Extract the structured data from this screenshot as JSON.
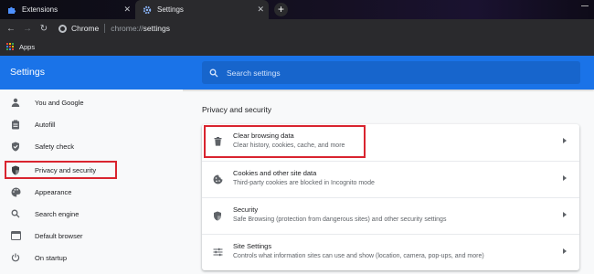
{
  "tabs": [
    {
      "label": "Extensions",
      "icon": "puzzle-icon"
    },
    {
      "label": "Settings",
      "icon": "gear-icon"
    }
  ],
  "toolbar": {
    "site_label": "Chrome",
    "url_scheme": "chrome://",
    "url_path": "settings"
  },
  "bookmarks": {
    "apps_label": "Apps"
  },
  "header": {
    "title": "Settings",
    "search_placeholder": "Search settings"
  },
  "sidebar": {
    "items": [
      {
        "label": "You and Google",
        "icon": "person-icon"
      },
      {
        "label": "Autofill",
        "icon": "clipboard-icon"
      },
      {
        "label": "Safety check",
        "icon": "shield-check-icon"
      },
      {
        "label": "Privacy and security",
        "icon": "shield-icon"
      },
      {
        "label": "Appearance",
        "icon": "palette-icon"
      },
      {
        "label": "Search engine",
        "icon": "search-icon"
      },
      {
        "label": "Default browser",
        "icon": "browser-icon"
      },
      {
        "label": "On startup",
        "icon": "power-icon"
      }
    ]
  },
  "main": {
    "section_title": "Privacy and security",
    "rows": [
      {
        "title": "Clear browsing data",
        "subtitle": "Clear history, cookies, cache, and more",
        "icon": "trash-icon"
      },
      {
        "title": "Cookies and other site data",
        "subtitle": "Third-party cookies are blocked in Incognito mode",
        "icon": "cookie-icon"
      },
      {
        "title": "Security",
        "subtitle": "Safe Browsing (protection from dangerous sites) and other security settings",
        "icon": "shield-icon"
      },
      {
        "title": "Site Settings",
        "subtitle": "Controls what information sites can use and show (location, camera, pop-ups, and more)",
        "icon": "sliders-icon"
      }
    ]
  },
  "colors": {
    "accent": "#1a73e8",
    "highlight": "#d9242f",
    "tab_strip": "#121018",
    "toolbar": "#2a2a2d"
  }
}
